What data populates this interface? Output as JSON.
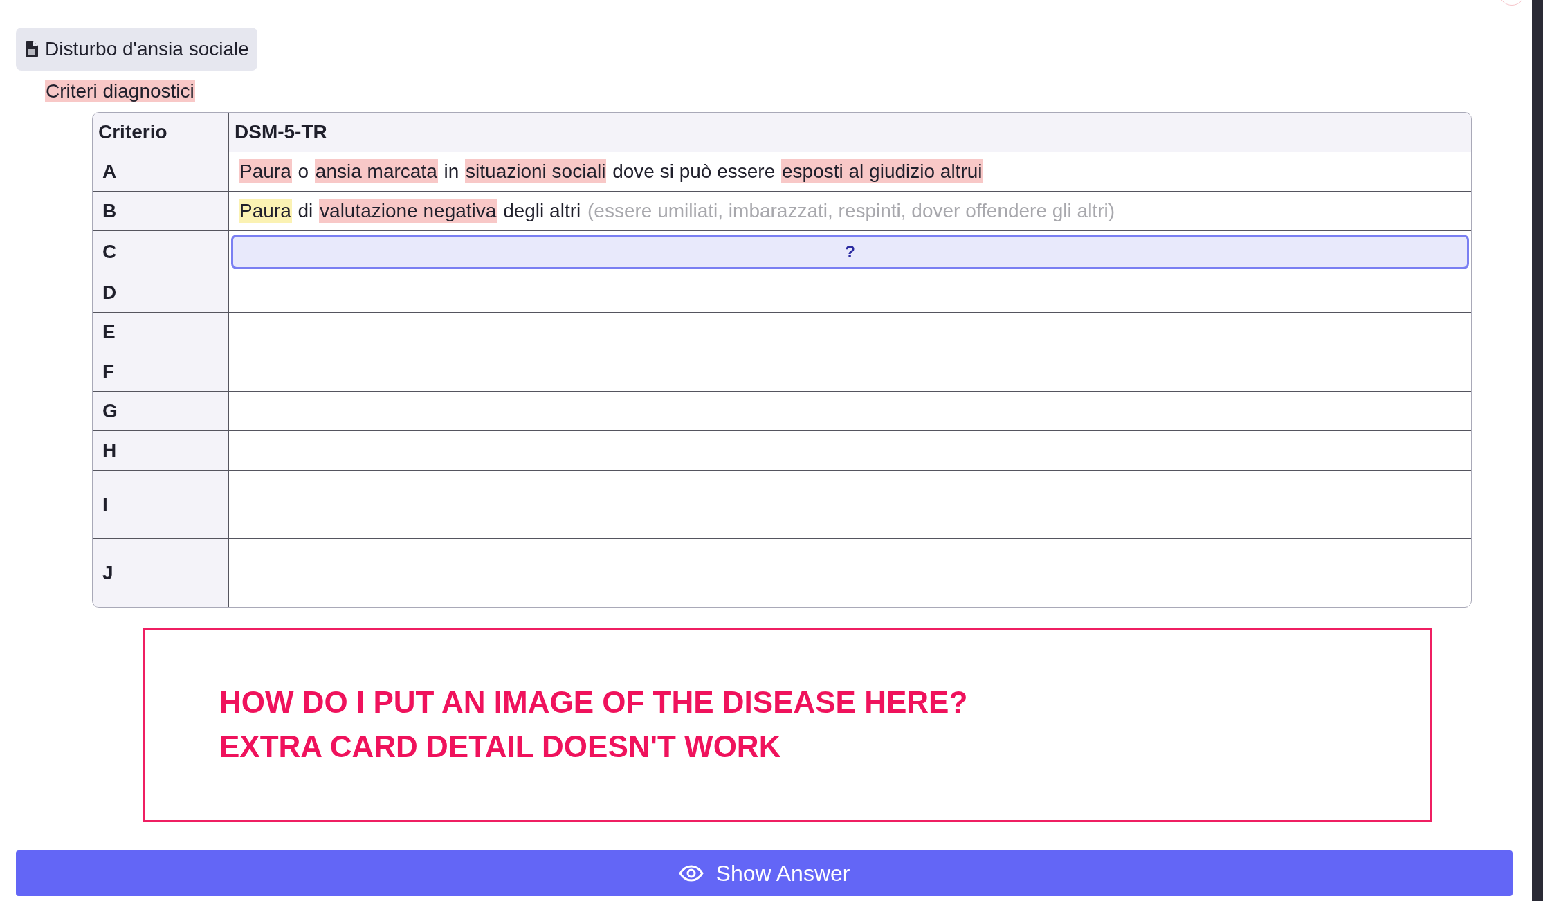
{
  "note_title": "Disturbo d'ansia sociale",
  "section_label": "Criteri diagnostici",
  "table": {
    "columns": [
      "Criterio",
      "DSM-5-TR"
    ],
    "rows": [
      {
        "label": "A",
        "kind": "text",
        "segments": [
          {
            "text": "Paura",
            "kind": "red"
          },
          {
            "text": "o",
            "kind": "plain"
          },
          {
            "text": "ansia marcata",
            "kind": "red"
          },
          {
            "text": "in",
            "kind": "plain"
          },
          {
            "text": "situazioni sociali",
            "kind": "red"
          },
          {
            "text": "dove si può essere",
            "kind": "plain"
          },
          {
            "text": "esposti al giudizio altrui",
            "kind": "red"
          }
        ]
      },
      {
        "label": "B",
        "kind": "text",
        "segments": [
          {
            "text": "Paura",
            "kind": "yellow"
          },
          {
            "text": "di",
            "kind": "plain"
          },
          {
            "text": "valutazione negativa",
            "kind": "red"
          },
          {
            "text": "degli altri",
            "kind": "plain"
          },
          {
            "text": "(essere umiliati, imbarazzati, respinti, dover offendere gli altri)",
            "kind": "muted"
          }
        ]
      },
      {
        "label": "C",
        "kind": "cloze",
        "cloze": "?"
      },
      {
        "label": "D",
        "kind": "blank"
      },
      {
        "label": "E",
        "kind": "blank"
      },
      {
        "label": "F",
        "kind": "blank"
      },
      {
        "label": "G",
        "kind": "blank"
      },
      {
        "label": "H",
        "kind": "blank"
      },
      {
        "label": "I",
        "kind": "tall-blank"
      },
      {
        "label": "J",
        "kind": "tall-blank"
      }
    ]
  },
  "annotation": [
    "HOW DO I PUT AN IMAGE OF THE DISEASE HERE?",
    "EXTRA CARD DETAIL DOESN'T WORK"
  ],
  "answer_button": "Show Answer"
}
